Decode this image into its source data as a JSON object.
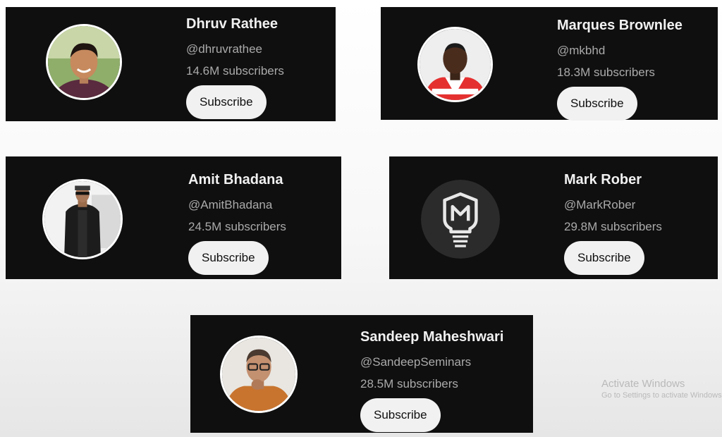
{
  "channels": [
    {
      "name": "Dhruv Rathee",
      "handle": "@dhruvrathee",
      "subscribers": "14.6M subscribers",
      "button": "Subscribe"
    },
    {
      "name": "Marques Brownlee",
      "handle": "@mkbhd",
      "subscribers": "18.3M subscribers",
      "button": "Subscribe"
    },
    {
      "name": "Amit Bhadana",
      "handle": "@AmitBhadana",
      "subscribers": "24.5M subscribers",
      "button": "Subscribe"
    },
    {
      "name": "Mark Rober",
      "handle": "@MarkRober",
      "subscribers": "29.8M subscribers",
      "button": "Subscribe"
    },
    {
      "name": "Sandeep Maheshwari",
      "handle": "@SandeepSeminars",
      "subscribers": "28.5M subscribers",
      "button": "Subscribe"
    }
  ],
  "watermark": {
    "title": "Activate Windows",
    "subtitle": "Go to Settings to activate Windows."
  },
  "colors": {
    "card_bg": "#0f0f0f",
    "button_bg": "#f1f1f1",
    "secondary_text": "#aaaaaa"
  }
}
